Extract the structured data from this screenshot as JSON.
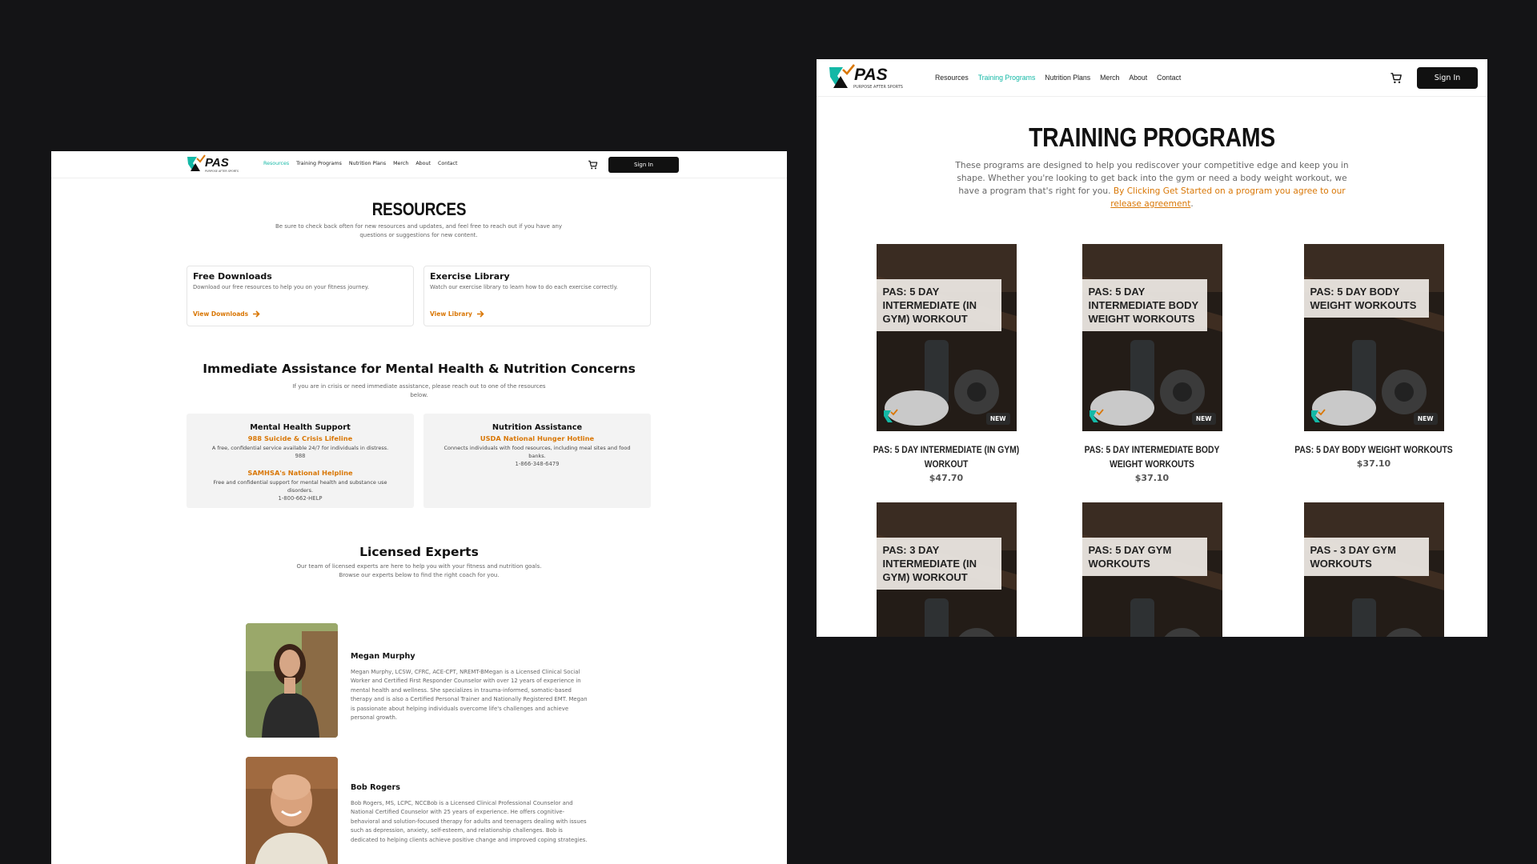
{
  "brand": {
    "logo_text": "PAS",
    "tagline": "PURPOSE AFTER SPORTS",
    "colors": {
      "teal": "#14b8a6",
      "orange": "#d97706",
      "dark": "#111111"
    }
  },
  "nav": {
    "links": [
      "Resources",
      "Training Programs",
      "Nutrition Plans",
      "Merch",
      "About",
      "Contact"
    ],
    "cart_icon": "cart-icon",
    "sign_in": "Sign In"
  },
  "resources_page": {
    "active_link": "Resources",
    "title": "RESOURCES",
    "subtitle": "Be sure to check back often for new resources and updates, and feel free to reach out if you have any questions or suggestions for new content.",
    "cards": [
      {
        "title": "Free Downloads",
        "desc": "Download our free resources to help you on your fitness journey.",
        "link": "View Downloads"
      },
      {
        "title": "Exercise Library",
        "desc": "Watch our exercise library to learn how to do each exercise correctly.",
        "link": "View Library"
      }
    ],
    "assistance": {
      "title": "Immediate Assistance for Mental Health & Nutrition Concerns",
      "subtitle": "If you are in crisis or need immediate assistance, please reach out to one of the resources below.",
      "mental_health": {
        "title": "Mental Health Support",
        "line1_name": "988 Suicide & Crisis Lifeline",
        "line1_desc": "A free, confidential service available 24/7 for individuals in distress.",
        "line1_phone": "988",
        "line2_name": "SAMHSA's National Helpline",
        "line2_desc": "Free and confidential support for mental health and substance use disorders.",
        "line2_phone": "1-800-662-HELP"
      },
      "nutrition": {
        "title": "Nutrition Assistance",
        "line1_name": "USDA National Hunger Hotline",
        "line1_desc": "Connects individuals with food resources, including meal sites and food banks.",
        "line1_phone": "1-866-348-6479"
      }
    },
    "experts": {
      "title": "Licensed Experts",
      "subtitle": "Our team of licensed experts are here to help you with your fitness and nutrition goals. Browse our experts below to find the right coach for you.",
      "list": [
        {
          "name": "Megan Murphy",
          "bio": "Megan Murphy, LCSW, CFRC, ACE-CPT, NREMT-BMegan is a Licensed Clinical Social Worker and Certified First Responder Counselor with over 12 years of experience in mental health and wellness. She specializes in trauma-informed, somatic-based therapy and is also a Certified Personal Trainer and Nationally Registered EMT. Megan is passionate about helping individuals overcome life's challenges and achieve personal growth."
        },
        {
          "name": "Bob Rogers",
          "bio": "Bob Rogers, MS, LCPC, NCCBob is a Licensed Clinical Professional Counselor and National Certified Counselor with 25 years of experience. He offers cognitive-behavioral and solution-focused therapy for adults and teenagers dealing with issues such as depression, anxiety, self-esteem, and relationship challenges. Bob is dedicated to helping clients achieve positive change and improved coping strategies."
        }
      ]
    }
  },
  "training_page": {
    "active_link": "Training Programs",
    "title": "TRAINING PROGRAMS",
    "intro": "These programs are designed to help you rediscover your competitive edge and keep you in shape. Whether you're looking to get back into the gym or need a body weight workout, we have a program that's right for you.",
    "agree_prefix": "By Clicking Get Started on a program you agree to our",
    "agree_link": "release agreement",
    "badge": "NEW",
    "products": [
      {
        "banner": "PAS: 5 DAY INTERMEDIATE (IN GYM) WORKOUT",
        "name": "PAS: 5 DAY INTERMEDIATE (IN GYM) WORKOUT",
        "price": "$47.70"
      },
      {
        "banner": "PAS: 5 DAY INTERMEDIATE BODY WEIGHT WORKOUTS",
        "name": "PAS: 5 DAY INTERMEDIATE BODY WEIGHT WORKOUTS",
        "price": "$37.10"
      },
      {
        "banner": "PAS: 5 DAY BODY WEIGHT WORKOUTS",
        "name": "PAS: 5 DAY BODY WEIGHT WORKOUTS",
        "price": "$37.10"
      },
      {
        "banner": "PAS: 3 DAY INTERMEDIATE (IN GYM) WORKOUT"
      },
      {
        "banner": "PAS: 5 DAY GYM WORKOUTS"
      },
      {
        "banner": "PAS - 3 DAY GYM WORKOUTS"
      }
    ]
  }
}
